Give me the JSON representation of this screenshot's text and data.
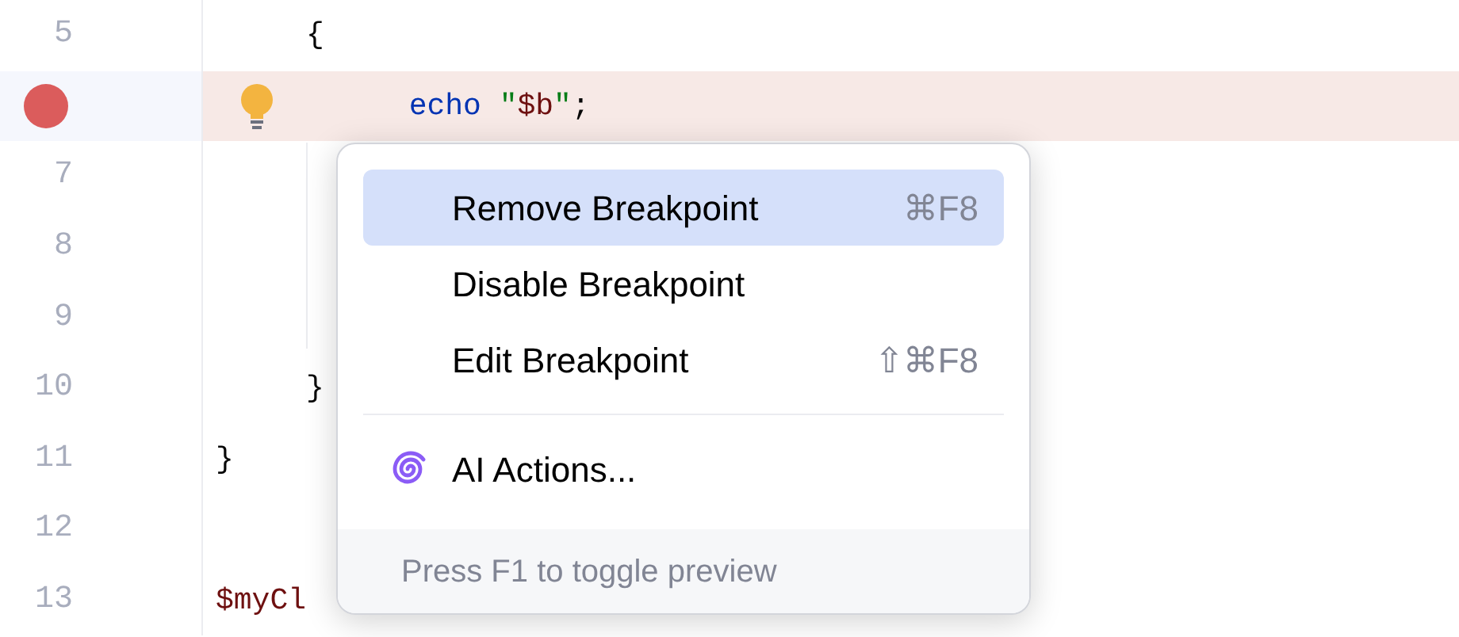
{
  "editor": {
    "lines": [
      {
        "number": "5",
        "breakpoint": false,
        "highlighted": false,
        "tokens": [
          {
            "kind": "punct",
            "text": "     {"
          }
        ]
      },
      {
        "breakpoint": true,
        "highlighted": true,
        "intention_bulb": true,
        "tokens": [
          {
            "kind": "keyword",
            "text": "       echo"
          },
          {
            "kind": "string",
            "text": " \""
          },
          {
            "kind": "variable",
            "text": "$b"
          },
          {
            "kind": "string",
            "text": "\""
          },
          {
            "kind": "punct",
            "text": ";"
          }
        ]
      },
      {
        "number": "7",
        "breakpoint": false,
        "highlighted": false
      },
      {
        "number": "8",
        "breakpoint": false,
        "highlighted": false
      },
      {
        "number": "9",
        "breakpoint": false,
        "highlighted": false
      },
      {
        "number": "10",
        "breakpoint": false,
        "highlighted": false,
        "tokens": [
          {
            "kind": "punct",
            "text": "     }"
          }
        ]
      },
      {
        "number": "11",
        "breakpoint": false,
        "highlighted": false,
        "tokens": [
          {
            "kind": "punct",
            "text": "}"
          }
        ]
      },
      {
        "number": "12",
        "breakpoint": false,
        "highlighted": false
      },
      {
        "number": "13",
        "breakpoint": false,
        "highlighted": false,
        "tokens": [
          {
            "kind": "variable",
            "text": "$myCl"
          }
        ]
      }
    ]
  },
  "context_menu": {
    "groups": [
      {
        "items": [
          {
            "kind": "plain",
            "label": "Remove Breakpoint",
            "shortcut": "⌘F8",
            "selected": true
          },
          {
            "kind": "plain",
            "label": "Disable Breakpoint",
            "selected": false
          },
          {
            "kind": "plain",
            "label": "Edit Breakpoint",
            "shortcut": "⇧⌘F8",
            "selected": false
          }
        ]
      },
      {
        "items": [
          {
            "kind": "ai",
            "label": "AI Actions...",
            "selected": false
          }
        ]
      }
    ],
    "footer": "Press F1 to toggle preview"
  }
}
